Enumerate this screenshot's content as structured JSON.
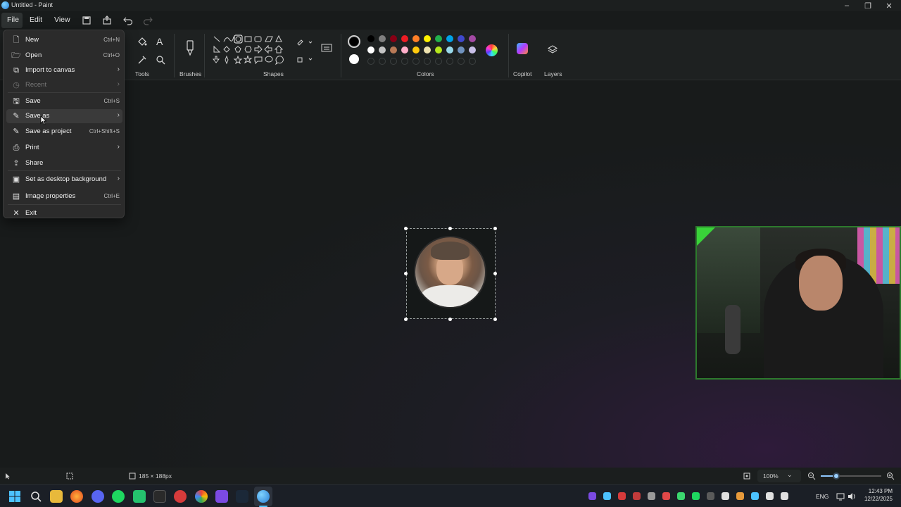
{
  "window": {
    "title": "Untitled - Paint"
  },
  "menubar": {
    "file": "File",
    "edit": "Edit",
    "view": "View"
  },
  "ribbon": {
    "groups": {
      "tools": "Tools",
      "brushes": "Brushes",
      "shapes": "Shapes",
      "colors": "Colors",
      "copilot": "Copilot",
      "layers": "Layers"
    },
    "palette_row1": [
      "#000000",
      "#7f7f7f",
      "#880015",
      "#ed1c24",
      "#ff7f27",
      "#fff200",
      "#22b14c",
      "#00a2e8",
      "#3f48cc",
      "#a349a4"
    ],
    "palette_row2": [
      "#ffffff",
      "#c3c3c3",
      "#b97a57",
      "#ffaec9",
      "#ffc90e",
      "#efe4b0",
      "#b5e61d",
      "#99d9ea",
      "#7092be",
      "#c8bfe7"
    ],
    "primary_color": "#000000",
    "secondary_color": "#ffffff"
  },
  "file_menu": {
    "items": [
      {
        "label": "New",
        "shortcut": "Ctrl+N",
        "icon": "new-file-icon"
      },
      {
        "label": "Open",
        "shortcut": "Ctrl+O",
        "icon": "open-folder-icon"
      },
      {
        "label": "Import to canvas",
        "shortcut": "",
        "icon": "import-icon",
        "submenu": true
      },
      {
        "label": "Recent",
        "shortcut": "",
        "icon": "recent-icon",
        "submenu": true,
        "disabled": true
      },
      {
        "label": "Save",
        "shortcut": "Ctrl+S",
        "icon": "save-icon"
      },
      {
        "label": "Save as",
        "shortcut": "",
        "icon": "save-as-icon",
        "submenu": true,
        "hover": true
      },
      {
        "label": "Save as project",
        "shortcut": "Ctrl+Shift+S",
        "icon": "save-project-icon"
      },
      {
        "label": "Print",
        "shortcut": "",
        "icon": "print-icon",
        "submenu": true
      },
      {
        "label": "Share",
        "shortcut": "",
        "icon": "share-icon"
      },
      {
        "label": "Set as desktop background",
        "shortcut": "",
        "icon": "desktop-background-icon",
        "submenu": true
      },
      {
        "label": "Image properties",
        "shortcut": "Ctrl+E",
        "icon": "image-properties-icon"
      },
      {
        "label": "Exit",
        "shortcut": "",
        "icon": "close-icon"
      }
    ]
  },
  "status": {
    "selection_size": "185 × 188px",
    "zoom": "100%",
    "zoom_level": 0.25
  },
  "taskbar": {
    "lang": "ENG",
    "time": "12:43 PM",
    "date": "12/22/2025"
  }
}
